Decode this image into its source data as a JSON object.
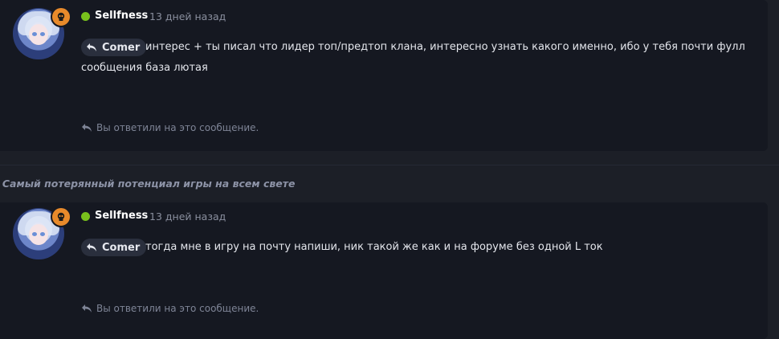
{
  "posts": [
    {
      "username": "Sellfness",
      "timestamp": "13 дней назад",
      "quote_label": "Comer",
      "message_line1": "интерес + ты писал что лидер топ/предтоп клана, интересно узнать какого именно, ибо у тебя почти фулл",
      "message_line2": "сообщения база лютая",
      "replied_note": "Вы ответили на это сообщение."
    },
    {
      "username": "Sellfness",
      "timestamp": "13 дней назад",
      "quote_label": "Comer",
      "message_line1": "тогда мне в игру на почту напиши, ник такой же как и на форуме без одной L ток",
      "replied_note": "Вы ответили на это сообщение."
    }
  ],
  "thread_title": "В Самый потерянный потенциал игры на всем свете",
  "colors": {
    "online": "#78c01c",
    "badge": "#e88a2b",
    "card_bg": "#151821",
    "page_bg": "#1c1f27"
  },
  "icons": {
    "badge": "skull-icon",
    "quote": "reply-arrow-icon",
    "replied": "reply-arrow-icon"
  }
}
